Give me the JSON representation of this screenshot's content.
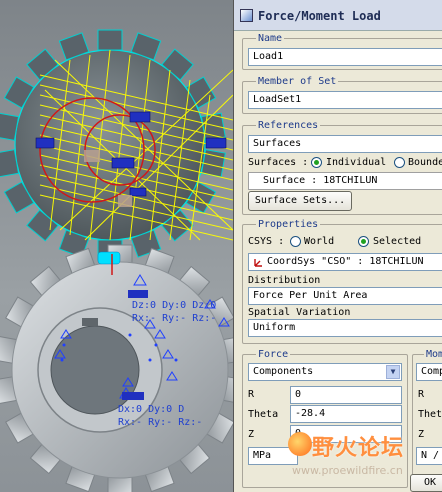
{
  "viewport": {
    "labels": [
      "Dz:0 Dy:0 Dz:0",
      "Rx:- Ry:- Rz:-",
      "Dx:0 Dy:0 D",
      "Rx:- Ry:- Rz:-"
    ]
  },
  "dialog": {
    "title": "Force/Moment Load",
    "name": {
      "label": "Name",
      "value": "Load1"
    },
    "member_of_set": {
      "label": "Member of Set",
      "value": "LoadSet1"
    },
    "references": {
      "label": "References",
      "type_value": "Surfaces",
      "surfaces_label": "Surfaces :",
      "individual": "Individual",
      "boundary": "Bounde",
      "surface_item": "Surface : 18TCHILUN",
      "surface_sets_button": "Surface Sets..."
    },
    "properties": {
      "label": "Properties",
      "csys_label": "CSYS :",
      "world": "World",
      "selected": "Selected",
      "csys_value": "CoordSys \"CSO\" : 18TCHILUN",
      "distribution_label": "Distribution",
      "distribution_value": "Force Per Unit Area",
      "spatial_label": "Spatial Variation",
      "spatial_value": "Uniform"
    },
    "force": {
      "label": "Force",
      "mode": "Components",
      "r_label": "R",
      "r_value": "0",
      "theta_label": "Theta",
      "theta_value": "-28.4",
      "z_label": "Z",
      "z_value": "0",
      "units": "MPa"
    },
    "moment": {
      "label": "Mom",
      "mode": "Comp",
      "r_label": "R",
      "theta_label": "Thet",
      "z_label": "Z",
      "units": "N /"
    },
    "ok_label": "OK"
  },
  "watermark": {
    "text": "野火论坛",
    "url": "www.proewildfire.cn"
  },
  "colors": {
    "load_arrows": "#ffff00",
    "gear_top": "#6b7479",
    "gear_bottom": "#b8bdc1",
    "outline": "#00e5e5",
    "accent_title": "#1d3a8a"
  }
}
